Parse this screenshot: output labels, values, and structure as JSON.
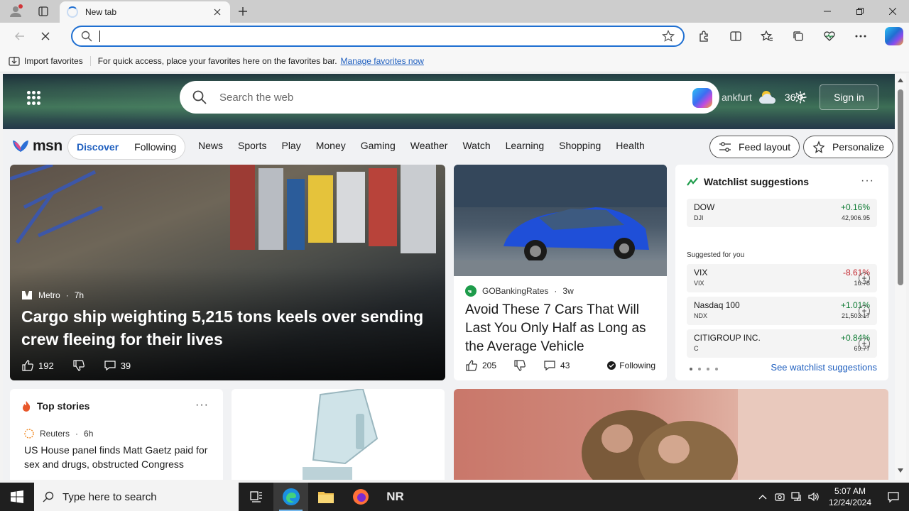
{
  "browser": {
    "tab_title": "New tab",
    "address_placeholder": "",
    "favbar": {
      "import_label": "Import favorites",
      "message": "For quick access, place your favorites here on the favorites bar.",
      "manage_link": "Manage favorites now"
    }
  },
  "msn": {
    "search_placeholder": "Search the web",
    "weather_location": "ankfurt",
    "weather_temp": "36°F",
    "signin_label": "Sign in",
    "logo_text": "msn",
    "feed_tabs": [
      "Discover",
      "Following"
    ],
    "categories": [
      "News",
      "Sports",
      "Play",
      "Money",
      "Gaming",
      "Weather",
      "Watch",
      "Learning",
      "Shopping",
      "Health"
    ],
    "feed_layout_label": "Feed layout",
    "personalize_label": "Personalize"
  },
  "hero": {
    "source": "Metro",
    "age": "7h",
    "title": "Cargo ship weighting 5,215 tons keels over sending crew fleeing for their lives",
    "likes": "192",
    "comments": "39"
  },
  "car_card": {
    "source": "GOBankingRates",
    "age": "3w",
    "title": "Avoid These 7 Cars That Will Last You Only Half as Long as the Average Vehicle",
    "likes": "205",
    "comments": "43",
    "following_label": "Following"
  },
  "watchlist": {
    "title": "Watchlist suggestions",
    "suggested_label": "Suggested for you",
    "see_more": "See watchlist suggestions",
    "main": {
      "name": "DOW",
      "symbol": "DJI",
      "change": "+0.16%",
      "value": "42,906.95"
    },
    "suggestions": [
      {
        "name": "VIX",
        "symbol": "VIX",
        "change": "-8.61%",
        "value": "16.78"
      },
      {
        "name": "Nasdaq 100",
        "symbol": "NDX",
        "change": "+1.01%",
        "value": "21,503.17"
      },
      {
        "name": "CITIGROUP INC.",
        "symbol": "C",
        "change": "+0.84%",
        "value": "69.77"
      }
    ]
  },
  "top_stories": {
    "title": "Top stories",
    "source": "Reuters",
    "age": "6h",
    "headline": "US House panel finds Matt Gaetz paid for sex and drugs, obstructed Congress"
  },
  "taskbar": {
    "search_placeholder": "Type here to search",
    "app_label": "NR",
    "time": "5:07 AM",
    "date": "12/24/2024"
  }
}
